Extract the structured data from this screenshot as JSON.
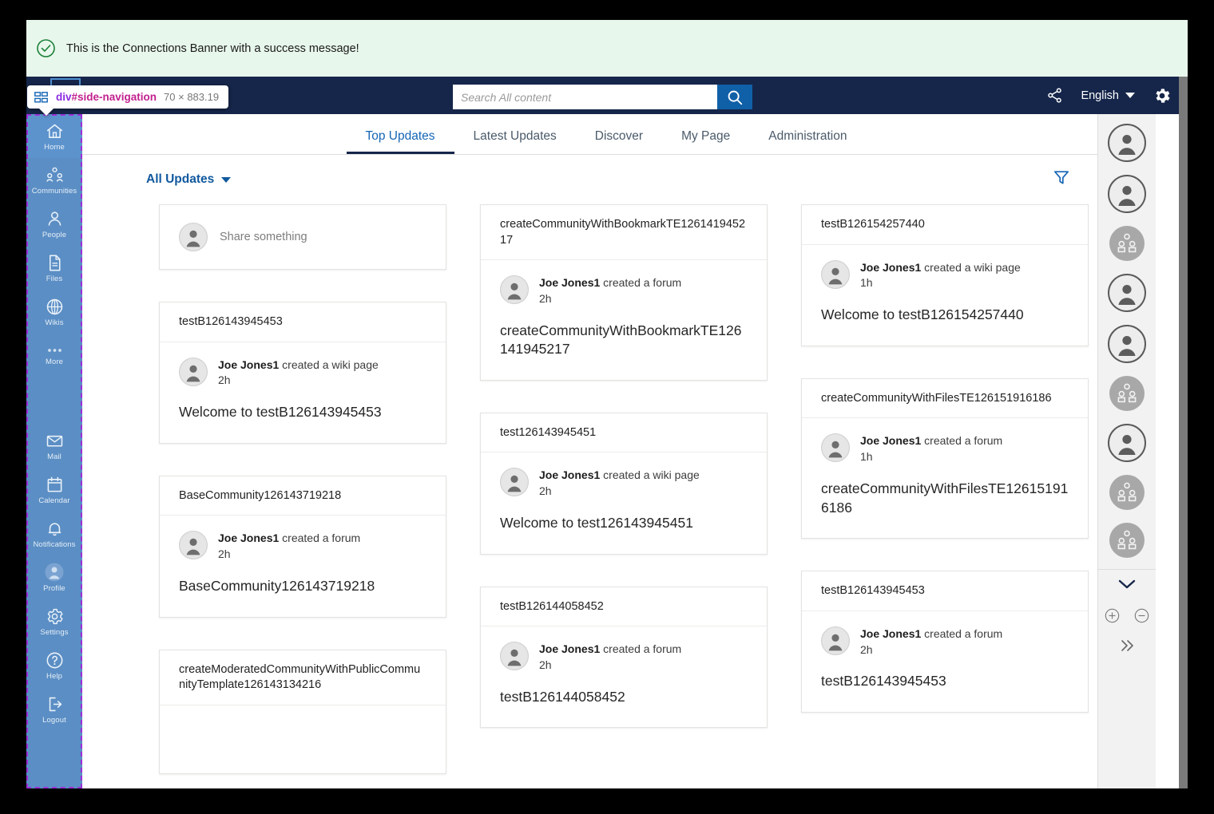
{
  "banner": {
    "icon": "check-circle-icon",
    "message": "This is the Connections Banner with a success message!",
    "bg_color": "#e8f7ec",
    "accent_color": "#1a7f37"
  },
  "inspector": {
    "icon": "dom-node-icon",
    "selector_tag": "div",
    "selector_id": "#side-navigation",
    "dimensions": "70 × 883.19"
  },
  "topbar": {
    "bg_color": "#16264a",
    "search": {
      "placeholder": "Search All content",
      "value": "",
      "button_icon": "search-icon",
      "button_color": "#1060a8"
    },
    "share_icon": "share-nodes-icon",
    "language": "English",
    "settings_icon": "gear-icon"
  },
  "side_nav": {
    "bg_color": "#5b8ec4",
    "items_top": [
      {
        "label": "Home",
        "icon": "home-icon",
        "active": true
      },
      {
        "label": "Communities",
        "icon": "communities-icon",
        "active": false
      },
      {
        "label": "People",
        "icon": "person-icon",
        "active": false
      },
      {
        "label": "Files",
        "icon": "file-icon",
        "active": false
      },
      {
        "label": "Wikis",
        "icon": "globe-icon",
        "active": false
      },
      {
        "label": "More",
        "icon": "ellipsis-icon",
        "active": false
      }
    ],
    "items_bottom": [
      {
        "label": "Mail",
        "icon": "envelope-icon"
      },
      {
        "label": "Calendar",
        "icon": "calendar-icon"
      },
      {
        "label": "Notifications",
        "icon": "bell-icon"
      },
      {
        "label": "Profile",
        "icon": "profile-avatar-icon"
      },
      {
        "label": "Settings",
        "icon": "gear-icon"
      },
      {
        "label": "Help",
        "icon": "question-circle-icon"
      },
      {
        "label": "Logout",
        "icon": "logout-icon"
      }
    ]
  },
  "tabs": [
    {
      "label": "Top Updates",
      "active": true
    },
    {
      "label": "Latest Updates",
      "active": false
    },
    {
      "label": "Discover",
      "active": false
    },
    {
      "label": "My Page",
      "active": false
    },
    {
      "label": "Administration",
      "active": false
    }
  ],
  "feed_header": {
    "filter_label": "All Updates",
    "dropdown_icon": "caret-down-icon",
    "filter_icon": "funnel-icon",
    "accent_color": "#11599e"
  },
  "share_box": {
    "avatar_icon": "person-avatar-icon",
    "placeholder": "Share something"
  },
  "columns": [
    {
      "cards": [
        {
          "title": "testB126143945453",
          "actor": "Joe Jones1",
          "action": "created a wiki page",
          "time": "2h",
          "content": "Welcome to testB126143945453",
          "avatar_icon": "person-avatar-icon"
        },
        {
          "title": "BaseCommunity126143719218",
          "actor": "Joe Jones1",
          "action": "created a forum",
          "time": "2h",
          "content": "BaseCommunity126143719218",
          "avatar_icon": "person-avatar-icon"
        },
        {
          "title": "createModeratedCommunityWithPublicCommunityTemplate126143134216",
          "actor": "",
          "action": "",
          "time": "",
          "content": "",
          "avatar_icon": "person-avatar-icon"
        }
      ]
    },
    {
      "cards": [
        {
          "title": "createCommunityWithBookmarkTE126141945217",
          "actor": "Joe Jones1",
          "action": "created a forum",
          "time": "2h",
          "content": "createCommunityWithBookmarkTE126141945217",
          "avatar_icon": "person-avatar-icon"
        },
        {
          "title": "test126143945451",
          "actor": "Joe Jones1",
          "action": "created a wiki page",
          "time": "2h",
          "content": "Welcome to test126143945451",
          "avatar_icon": "person-avatar-icon"
        },
        {
          "title": "testB126144058452",
          "actor": "Joe Jones1",
          "action": "created a forum",
          "time": "2h",
          "content": "testB126144058452",
          "avatar_icon": "person-avatar-icon"
        }
      ]
    },
    {
      "cards": [
        {
          "title": "testB126154257440",
          "actor": "Joe Jones1",
          "action": "created a wiki page",
          "time": "1h",
          "content": "Welcome to testB126154257440",
          "avatar_icon": "person-avatar-icon"
        },
        {
          "title": "createCommunityWithFilesTE126151916186",
          "actor": "Joe Jones1",
          "action": "created a forum",
          "time": "1h",
          "content": "createCommunityWithFilesTE126151916186",
          "avatar_icon": "person-avatar-icon"
        },
        {
          "title": "testB126143945453",
          "actor": "Joe Jones1",
          "action": "created a forum",
          "time": "2h",
          "content": "testB126143945453",
          "avatar_icon": "person-avatar-icon"
        }
      ]
    }
  ],
  "right_rail": {
    "bg_color": "#f2f2f2",
    "entries": [
      {
        "icon": "person-avatar-icon",
        "type": "person"
      },
      {
        "icon": "person-avatar-icon",
        "type": "person"
      },
      {
        "icon": "community-icon",
        "type": "community"
      },
      {
        "icon": "person-avatar-icon",
        "type": "person"
      },
      {
        "icon": "person-avatar-icon",
        "type": "person"
      },
      {
        "icon": "community-icon",
        "type": "community"
      },
      {
        "icon": "person-avatar-icon",
        "type": "person"
      },
      {
        "icon": "community-icon",
        "type": "community"
      },
      {
        "icon": "community-icon",
        "type": "community"
      }
    ],
    "controls": {
      "expand_icon": "chevron-down-icon",
      "zoom_in_icon": "plus-circle-icon",
      "zoom_out_icon": "minus-circle-icon",
      "collapse_icon": "double-chevron-right-icon"
    }
  }
}
